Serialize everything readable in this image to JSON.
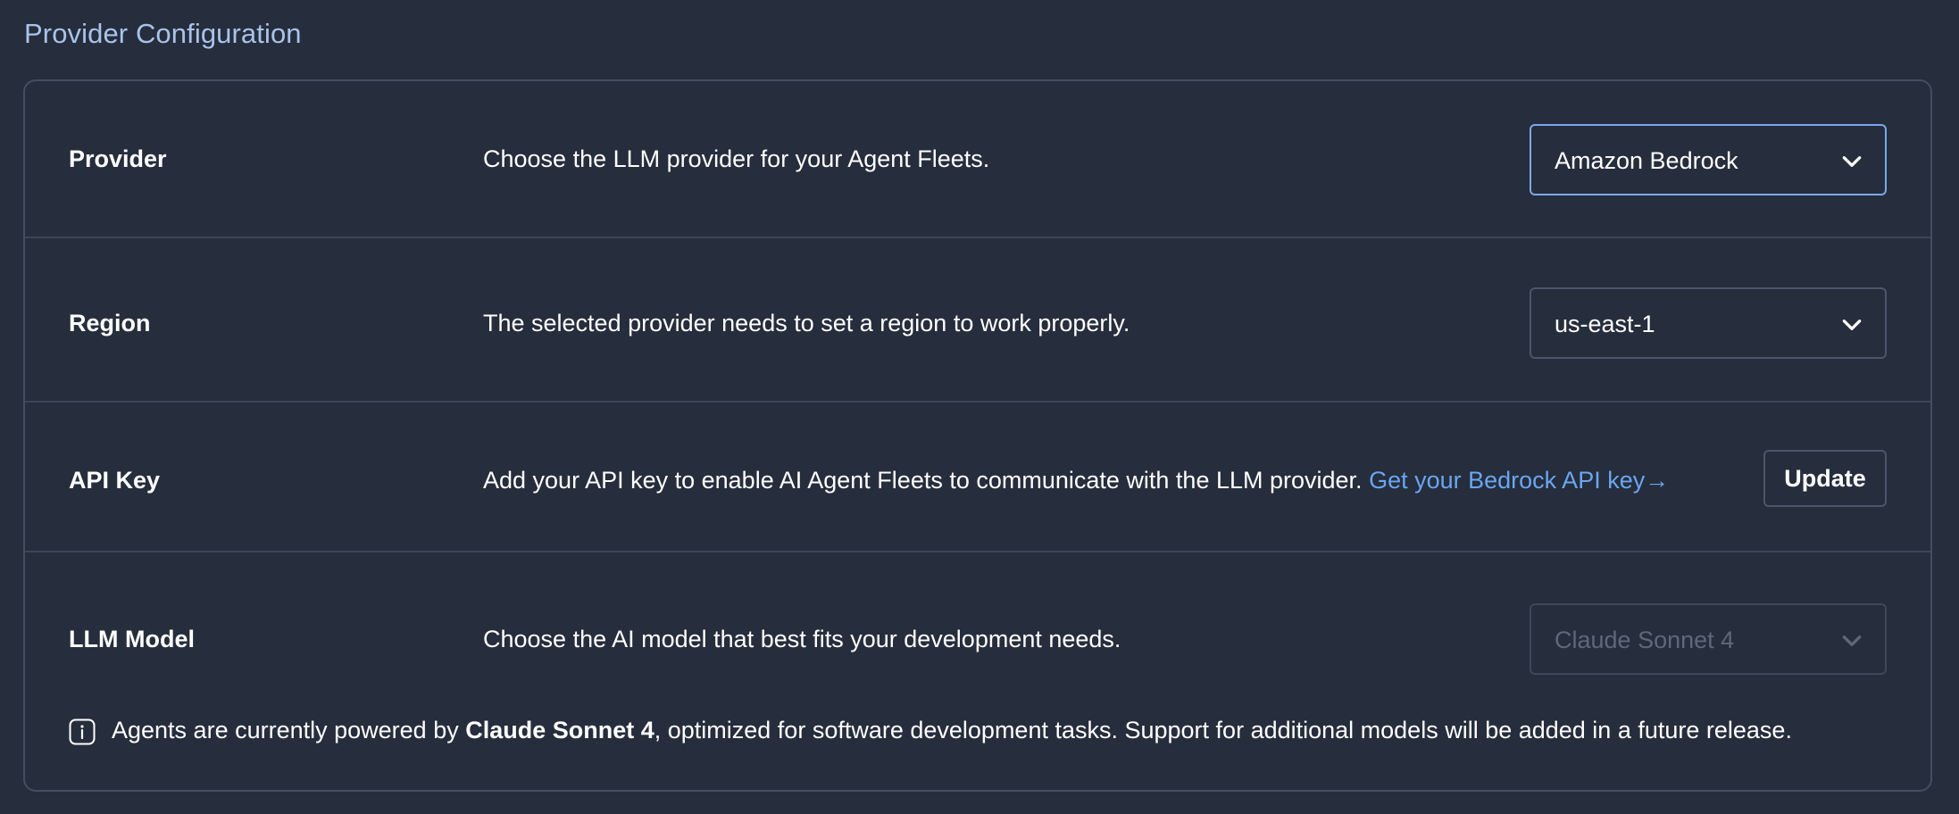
{
  "section": {
    "title": "Provider Configuration"
  },
  "rows": {
    "provider": {
      "label": "Provider",
      "description": "Choose the LLM provider for your Agent Fleets.",
      "selected": "Amazon Bedrock"
    },
    "region": {
      "label": "Region",
      "description": "The selected provider needs to set a region to work properly.",
      "selected": "us-east-1"
    },
    "api_key": {
      "label": "API Key",
      "description": "Add your API key to enable AI Agent Fleets to communicate with the LLM provider.",
      "link_text": "Get your Bedrock API key",
      "link_arrow": "→",
      "button_label": "Update"
    },
    "llm_model": {
      "label": "LLM Model",
      "description": "Choose the AI model that best fits your development needs.",
      "selected": "Claude Sonnet 4",
      "info_prefix": "Agents are currently powered by ",
      "info_bold": "Claude Sonnet 4",
      "info_suffix": ", optimized for software development tasks. Support for additional models will be added in a future release."
    }
  },
  "colors": {
    "background": "#262d3c",
    "accent_link": "#6aa6f0",
    "title": "#a9c3ea",
    "focus_border": "#7aa8ea"
  },
  "icons": {
    "chevron": "chevron-down-icon",
    "info": "info-icon"
  }
}
